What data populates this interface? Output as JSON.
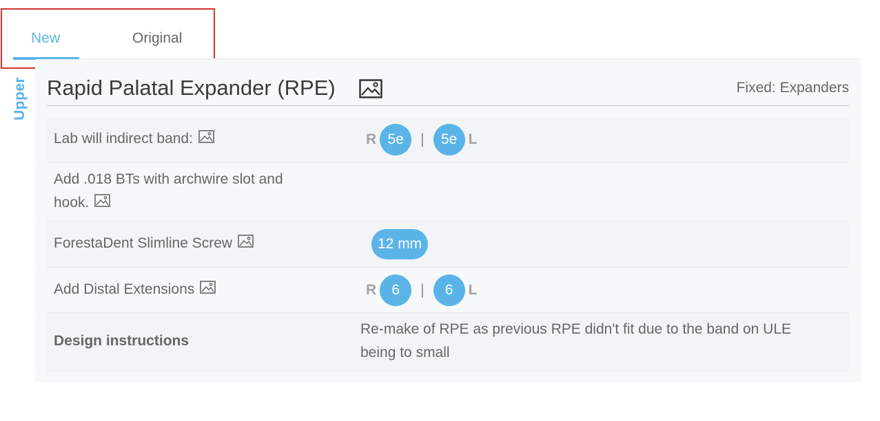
{
  "tabs": [
    {
      "label": "New",
      "active": true
    },
    {
      "label": "Original",
      "active": false
    }
  ],
  "section": {
    "side_label": "Upper",
    "title": "Rapid Palatal Expander (RPE)",
    "category": "Fixed: Expanders"
  },
  "rows": {
    "band": {
      "label": "Lab will indirect band:",
      "right_side": "R",
      "right_value": "5e",
      "separator": "|",
      "left_value": "5e",
      "left_side": "L"
    },
    "bts": {
      "label_line1": "Add .018 BTs with archwire slot and",
      "label_line2": "hook."
    },
    "screw": {
      "label": "ForestaDent Slimline Screw",
      "value": "12 mm"
    },
    "distal": {
      "label": "Add Distal Extensions",
      "right_side": "R",
      "right_value": "6",
      "separator": "|",
      "left_value": "6",
      "left_side": "L"
    },
    "design": {
      "label": "Design instructions",
      "text_line1": "Re-make of RPE as previous RPE didn't fit due to the band on ULE",
      "text_line2": "being to small"
    }
  },
  "colors": {
    "accent": "#5ab4e8",
    "highlight_border": "#d32f2f"
  },
  "icons": {
    "image": "image-icon"
  }
}
